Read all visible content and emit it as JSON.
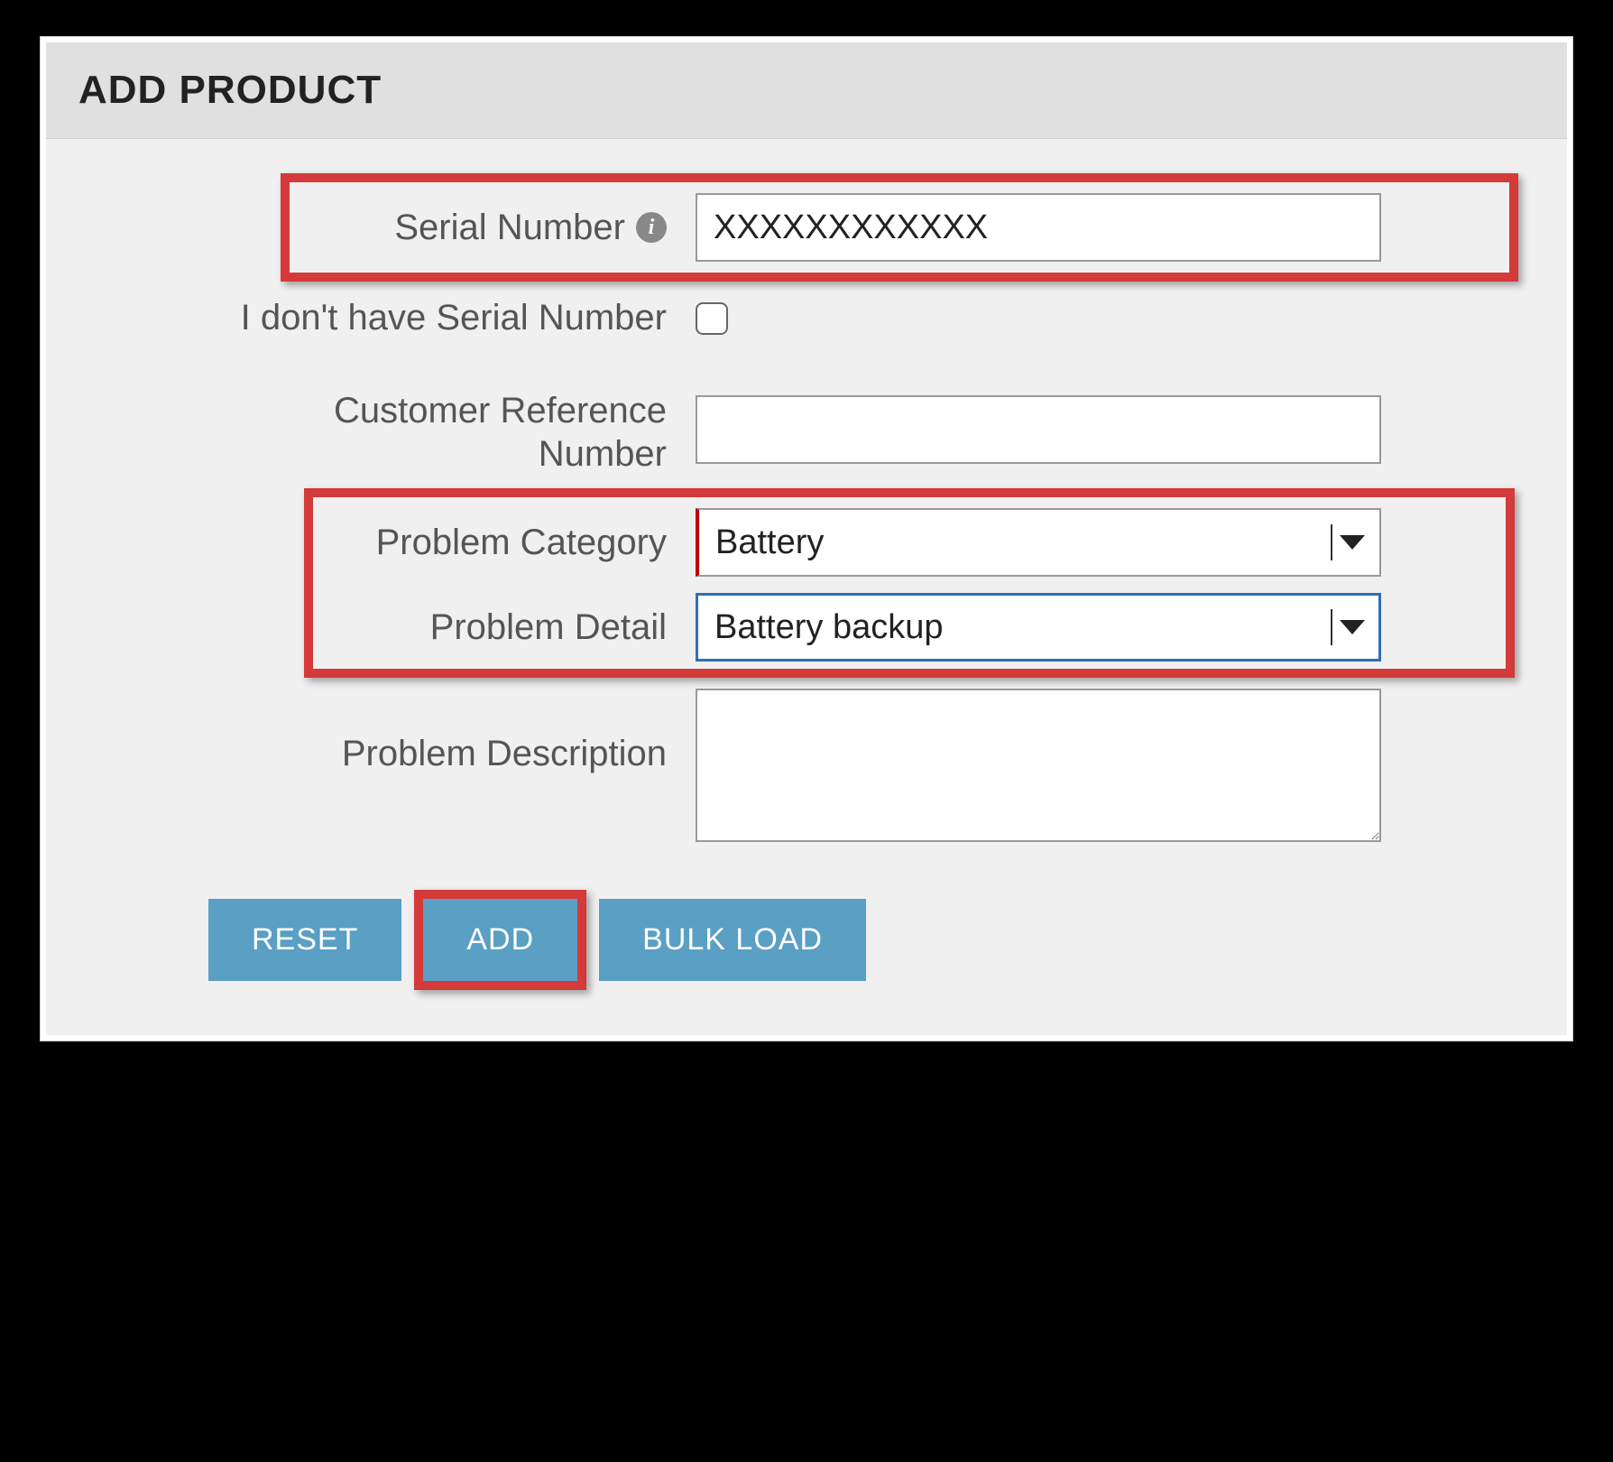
{
  "panel": {
    "title": "ADD PRODUCT"
  },
  "form": {
    "serial_number": {
      "label": "Serial Number",
      "value": "XXXXXXXXXXXX",
      "info_icon": "info-icon"
    },
    "no_serial": {
      "label": "I don't have Serial Number",
      "checked": false
    },
    "customer_reference": {
      "label_line1": "Customer Reference",
      "label_line2": "Number",
      "value": ""
    },
    "problem_category": {
      "label": "Problem Category",
      "value": "Battery"
    },
    "problem_detail": {
      "label": "Problem Detail",
      "value": "Battery backup"
    },
    "problem_description": {
      "label": "Problem Description",
      "value": ""
    }
  },
  "buttons": {
    "reset": "RESET",
    "add": "ADD",
    "bulk_load": "BULK LOAD"
  },
  "colors": {
    "highlight": "#d43a3a",
    "button": "#5a9fc4",
    "required_accent": "#b00",
    "select_focus": "#2d6fb8"
  }
}
